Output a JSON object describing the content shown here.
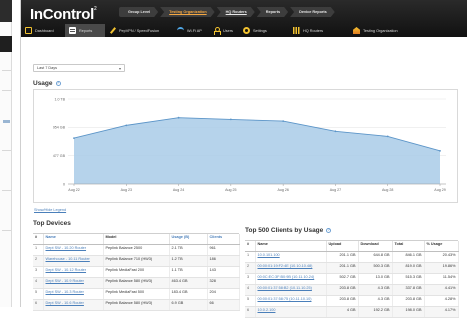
{
  "app": {
    "logo": "InControl",
    "logo_mark": "2"
  },
  "breadcrumbs": [
    {
      "label": "Group Level",
      "active": false,
      "underline": false
    },
    {
      "label": "Testing Organization",
      "active": true,
      "underline": true
    },
    {
      "label": "HQ Routers",
      "active": false,
      "underline": true
    },
    {
      "label": "Reports",
      "active": false,
      "underline": false
    },
    {
      "label": "Device Reports",
      "active": false,
      "underline": false
    }
  ],
  "nav": [
    {
      "label": "Dashboard",
      "icon": "dashboard-icon"
    },
    {
      "label": "Reports",
      "icon": "reports-icon",
      "active": true
    },
    {
      "label": "PepVPN / SpeedFusion",
      "icon": "pepvpn-icon"
    },
    {
      "label": "Wi-Fi AP",
      "icon": "wifi-icon"
    },
    {
      "label": "Users",
      "icon": "users-icon"
    },
    {
      "label": "Settings",
      "icon": "settings-icon"
    },
    {
      "label": "HQ Routers",
      "icon": "grid-icon"
    },
    {
      "label": "Testing Organization",
      "icon": "organization-icon"
    }
  ],
  "period_select": {
    "value": "Last 7 Days"
  },
  "usage": {
    "title": "Usage",
    "show_legend": "Show/Hide Legend"
  },
  "chart_data": {
    "type": "area",
    "title": "Usage",
    "categories": [
      "Aug 22",
      "Aug 23",
      "Aug 24",
      "Aug 25",
      "Aug 26",
      "Aug 27",
      "Aug 28",
      "Aug 29"
    ],
    "series": [
      {
        "values": [
          540,
          690,
          780,
          760,
          740,
          620,
          560,
          390
        ]
      }
    ],
    "yticks": [
      "1.0 TB",
      "954 GB",
      "477 GB",
      "0"
    ],
    "ylim": [
      0,
      1000
    ],
    "grid": true,
    "colors": {
      "fill": "#a9cbe8",
      "line": "#5c95c8"
    }
  },
  "top_devices": {
    "title": "Top Devices",
    "columns": [
      "#",
      "Name",
      "Model",
      "Usage (B)",
      "Clients"
    ],
    "rows": [
      [
        "1",
        "Dept SW - 10.20 Router",
        "Peplink Balance 2500",
        "2.1 TB",
        "961"
      ],
      [
        "2",
        "Warehouse - 10.11 Router",
        "Peplink Balance 710 (HW3)",
        "1.2 TB",
        "186"
      ],
      [
        "3",
        "Dept SW - 10.12 Router",
        "Peplink MediaFast 200",
        "1.1 TB",
        "143"
      ],
      [
        "4",
        "Dept SW - 10.9 Router",
        "Peplink Balance 580 (HW3)",
        "463.4 GB",
        "328"
      ],
      [
        "5",
        "Dept SW - 10.3 Router",
        "Peplink MediaFast 500",
        "183.4 GB",
        "204"
      ],
      [
        "6",
        "Dept SW - 10.6 Router",
        "Peplink Balance 580 (HW3)",
        "6.9 GB",
        "66"
      ]
    ]
  },
  "top_clients": {
    "title": "Top 500 Clients by Usage",
    "columns": [
      "#",
      "Name",
      "Upload",
      "Download",
      "Total",
      "% Usage"
    ],
    "rows": [
      [
        "1",
        "10.0.101.100",
        "201.1 GB",
        "644.8 GB",
        "846.1 GB",
        "20.43%"
      ],
      [
        "2",
        "00:00:01:19:F2:4E (10.10.10.48)",
        "201.1 GB",
        "500.3 GB",
        "819.0 GB",
        "19.86%"
      ],
      [
        "3",
        "00:0C:EC:3F:B0:9B (10.11.10.24)",
        "502.7 GB",
        "13.0 GB",
        "515.3 GB",
        "11.54%"
      ],
      [
        "4",
        "00:00:01:37:58:B2 (10.11.10.25)",
        "203.8 GB",
        "4.3 GB",
        "337.8 GB",
        "4.41%"
      ],
      [
        "5",
        "00:00:01:37:58:75 (10.11.10.10)",
        "203.8 GB",
        "4.3 GB",
        "203.8 GB",
        "4.28%"
      ],
      [
        "6",
        "10.0.2.100",
        "4 GB",
        "192.2 GB",
        "198.0 GB",
        "4.17%"
      ]
    ]
  }
}
